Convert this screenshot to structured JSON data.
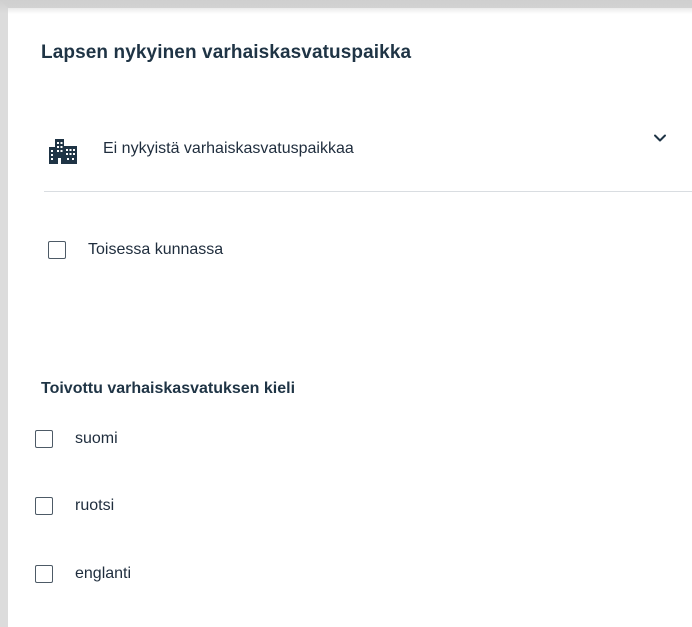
{
  "current_place": {
    "title": "Lapsen nykyinen varhaiskasvatuspaikka",
    "select": {
      "icon": "building-icon",
      "selected_value": "Ei nykyistä varhaiskasvatuspaikkaa",
      "chevron_icon": "chevron-down-icon"
    },
    "other_municipality_label": "Toisessa kunnassa",
    "other_municipality_checked": false
  },
  "language": {
    "title": "Toivottu varhaiskasvatuksen kieli",
    "options": [
      {
        "label": "suomi",
        "checked": false
      },
      {
        "label": "ruotsi",
        "checked": false
      },
      {
        "label": "englanti",
        "checked": false
      }
    ]
  },
  "colors": {
    "heading": "#1f3445",
    "text": "#1f2d3d",
    "icon": "#1f3445",
    "divider": "#d9dde1",
    "checkbox_border": "#4d5a66"
  }
}
